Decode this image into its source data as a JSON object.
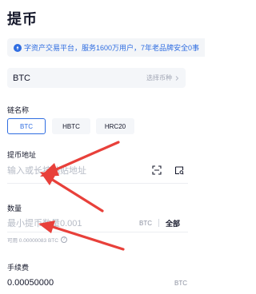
{
  "page": {
    "title": "提币"
  },
  "notice": {
    "text": "字资产交易平台，服务1600万用户，7年老品牌安全0事",
    "icon": "info-icon",
    "color": "#2f6de1"
  },
  "coin_selector": {
    "value": "BTC",
    "hint": "选择币种",
    "icon": "chevron-right-icon"
  },
  "chain": {
    "label": "链名称",
    "options": [
      {
        "label": "BTC",
        "selected": true
      },
      {
        "label": "HBTC",
        "selected": false
      },
      {
        "label": "HRC20",
        "selected": false
      }
    ]
  },
  "address": {
    "label": "提币地址",
    "placeholder": "输入或长按粘贴地址",
    "icons": [
      "scan-icon",
      "address-book-icon"
    ]
  },
  "amount": {
    "label": "数量",
    "placeholder": "最小提币数量0.001",
    "unit": "BTC",
    "all_label": "全部",
    "available": "可用 0.00000083 BTC",
    "help_icon": "question-icon"
  },
  "fee": {
    "label": "手续费",
    "value": "0.00050000",
    "unit": "BTC"
  },
  "colors": {
    "accent": "#2f6de1",
    "annotation_arrow": "#e8403a"
  }
}
